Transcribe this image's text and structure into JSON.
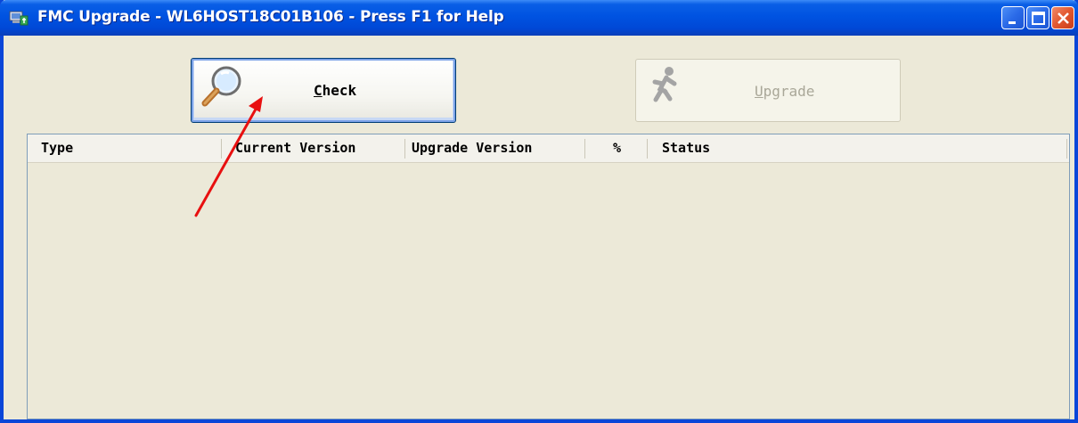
{
  "window": {
    "title": "FMC Upgrade - WL6HOST18C01B106 - Press F1 for Help",
    "controls": [
      "minimize-icon",
      "maximize-icon",
      "close-icon"
    ]
  },
  "toolbar": {
    "check": {
      "prefix": "C",
      "rest": "heck",
      "icon": "magnifier-icon"
    },
    "upgrade": {
      "prefix": "U",
      "rest": "pgrade",
      "icon": "running-man-icon",
      "enabled": false
    }
  },
  "list": {
    "columns": [
      "Type",
      "Current Version",
      "Upgrade Version",
      "%",
      "Status"
    ],
    "rows": []
  },
  "annotation": {
    "color": "#e81010",
    "target": "check-button"
  }
}
